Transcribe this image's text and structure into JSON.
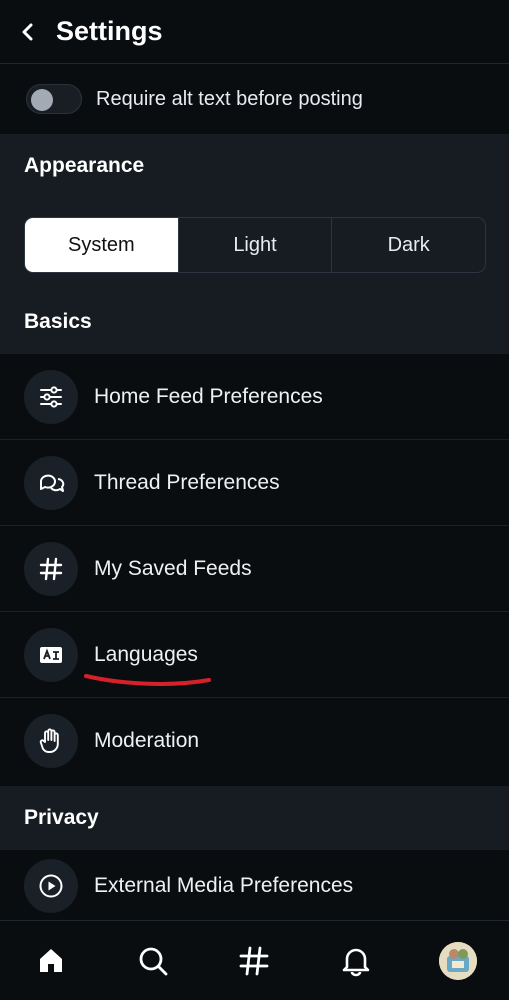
{
  "header": {
    "title": "Settings",
    "back_icon": "chevron-left-icon"
  },
  "alt_text_toggle": {
    "label": "Require alt text before posting",
    "on": false
  },
  "appearance": {
    "heading": "Appearance",
    "options": [
      "System",
      "Light",
      "Dark"
    ],
    "selected": "System"
  },
  "basics": {
    "heading": "Basics",
    "items": [
      {
        "label": "Home Feed Preferences",
        "icon": "sliders-icon"
      },
      {
        "label": "Thread Preferences",
        "icon": "chat-bubbles-icon"
      },
      {
        "label": "My Saved Feeds",
        "icon": "hash-icon"
      },
      {
        "label": "Languages",
        "icon": "language-icon"
      },
      {
        "label": "Moderation",
        "icon": "hand-icon"
      }
    ]
  },
  "privacy": {
    "heading": "Privacy",
    "items": [
      {
        "label": "External Media Preferences",
        "icon": "play-circle-icon"
      }
    ]
  },
  "annotation": {
    "color": "#d8202a"
  },
  "tabbar": {
    "tabs": [
      "home-icon",
      "search-icon",
      "feeds-hash-icon",
      "notifications-icon",
      "profile-avatar"
    ]
  }
}
